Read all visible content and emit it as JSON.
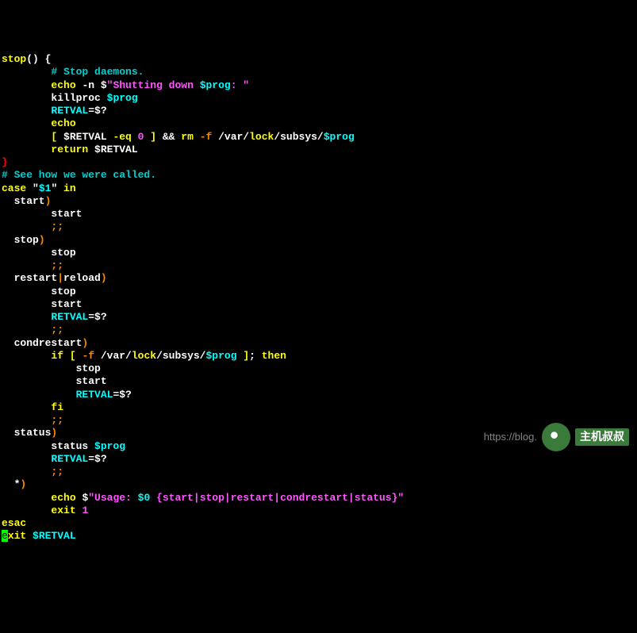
{
  "code": {
    "t1": "stop",
    "t2": "() {",
    "c1": "# Stop daemons.",
    "t3": "echo",
    "t4": " -n $",
    "s1": "\"Shutting down ",
    "v1": "$prog",
    "s2": ": \"",
    "t5": "killproc ",
    "v2": "$prog",
    "t6": "RETVAL",
    "t7": "=$?",
    "t8": "echo",
    "t9": "[",
    "t10": " $RETVAL ",
    "t11": "-eq",
    "t12": " 0",
    "t13": " ] ",
    "t14": "&&",
    "t15": " rm",
    "t16": " -f",
    "t17": " /var/",
    "t18": "lock",
    "t19": "/subsys/",
    "v3": "$prog",
    "t20": "return",
    "v4": " $RETVAL",
    "t21": "}",
    "c2": "# See how we were called.",
    "t22": "case",
    "t23": " \"",
    "v5": "$1",
    "t24": "\"",
    "t25": " in",
    "l_start": "  start",
    "paren": ")",
    "call_start": "start",
    "semis": ";;",
    "l_stop": "  stop",
    "call_stop": "stop",
    "l_restart": "  restart",
    "pipe": "|",
    "l_reload": "reload",
    "retvalassign": "RETVAL",
    "eqdq": "=$?",
    "l_cond": "  condrestart",
    "if1": "if",
    "if2": " [",
    "if3": " -f",
    "if4": " /var/",
    "if5": "lock",
    "if6": "/subsys/",
    "v6": "$prog",
    "if7": " ]",
    "if8": ";",
    "if9": " then",
    "fi": "fi",
    "l_status": "  status",
    "call_status": "status ",
    "v7": "$prog",
    "wild": "  *",
    "echo2": "echo",
    "dol": " $",
    "usage1": "\"Usage: ",
    "v8": "$0",
    "usage2": " {start|stop|restart|condrestart|status}\"",
    "exit1": "exit",
    "exit1n": " 1",
    "esac": "esac",
    "exit2a": "e",
    "exit2b": "xit ",
    "v9": "$RETVAL"
  },
  "watermark": {
    "url": "https://blog.",
    "brand": "主机叔叔"
  }
}
